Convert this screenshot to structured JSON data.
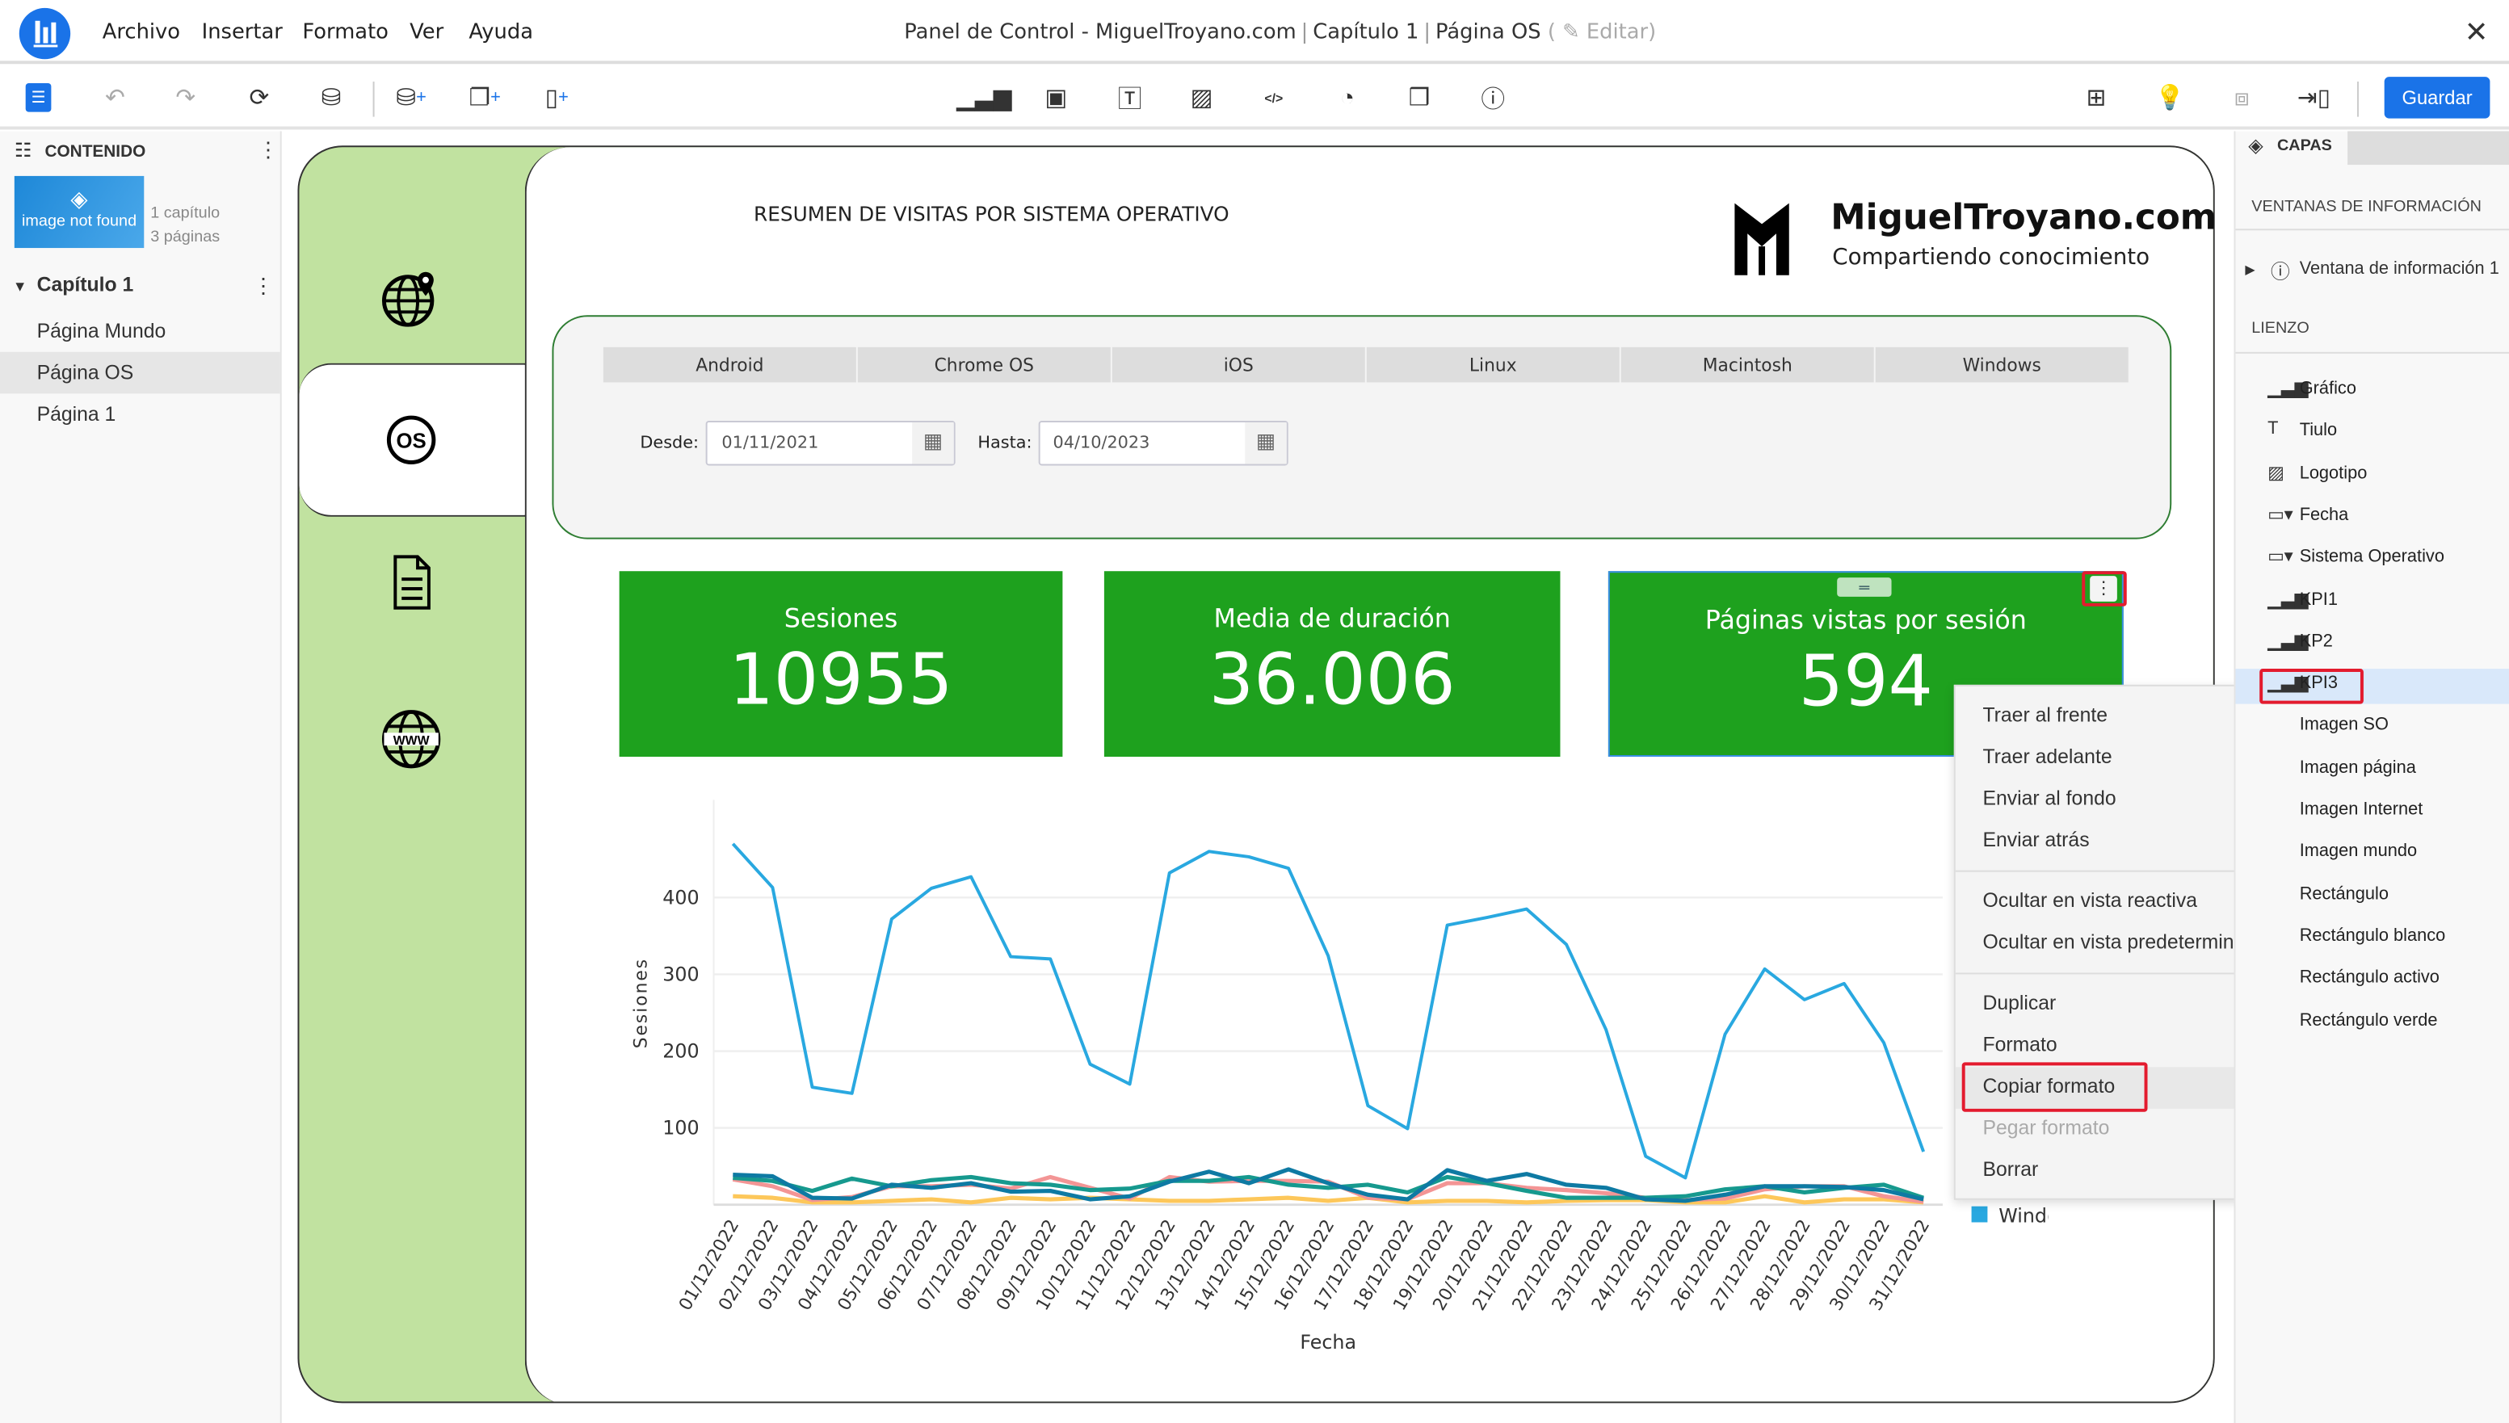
{
  "app": {
    "menu": [
      "Archivo",
      "Insertar",
      "Formato",
      "Ver",
      "Ayuda"
    ],
    "title": {
      "dashboard": "Panel de Control - MiguelTroyano.com",
      "chapter": "Capítulo 1",
      "page": "Página OS",
      "edit": "Editar"
    },
    "save_label": "Guardar"
  },
  "toolbar": {
    "icons": [
      "list-icon",
      "undo-icon",
      "redo-icon",
      "refresh-icon",
      "database-info-icon",
      "add-database-icon",
      "add-copy-page-icon",
      "add-page-icon",
      "chart-icon",
      "dropdown-icon",
      "text-icon",
      "image-icon",
      "html-icon",
      "shape-icon",
      "container-icon",
      "info-window-icon",
      "layout-icon",
      "bulb-chart-icon",
      "fit-icon",
      "resize-icon"
    ]
  },
  "content": {
    "header": "CONTENIDO",
    "thumb_text": "image not found",
    "chapters_count": "1 capítulo",
    "pages_count": "3 páginas",
    "chapter": "Capítulo 1",
    "pages": [
      "Página Mundo",
      "Página OS",
      "Página 1"
    ],
    "selected_page": "Página OS"
  },
  "layers": {
    "tab": "CAPAS",
    "section_info": "VENTANAS DE INFORMACIÓN",
    "info_window": "Ventana de información 1",
    "section_canvas": "LIENZO",
    "items": [
      {
        "label": "Gráfico",
        "icon": "chart-icon"
      },
      {
        "label": "Tiulo",
        "icon": "text-icon"
      },
      {
        "label": "Logotipo",
        "icon": "image-icon"
      },
      {
        "label": "Fecha",
        "icon": "dropdown-icon"
      },
      {
        "label": "Sistema Operativo",
        "icon": "dropdown-icon"
      },
      {
        "label": "KPI1",
        "icon": "chart-icon"
      },
      {
        "label": "KP2",
        "icon": "chart-icon"
      },
      {
        "label": "KPI3",
        "icon": "chart-icon"
      },
      {
        "label": "Imagen SO",
        "icon": "image-icon"
      },
      {
        "label": "Imagen página",
        "icon": "image-icon"
      },
      {
        "label": "Imagen Internet",
        "icon": "image-icon"
      },
      {
        "label": "Imagen mundo",
        "icon": "image-icon"
      },
      {
        "label": "Rectángulo",
        "icon": "shape-icon"
      },
      {
        "label": "Rectángulo blanco",
        "icon": "shape-icon"
      },
      {
        "label": "Rectángulo activo",
        "icon": "shape-icon"
      },
      {
        "label": "Rectángulo verde",
        "icon": "shape-icon"
      }
    ],
    "selected": "KPI3"
  },
  "page": {
    "title": "RESUMEN DE VISITAS POR SISTEMA OPERATIVO",
    "brand": "MiguelTroyano.com",
    "tagline": "Compartiendo conocimiento",
    "os_tabs": [
      "Android",
      "Chrome OS",
      "iOS",
      "Linux",
      "Macintosh",
      "Windows"
    ],
    "from_label": "Desde:",
    "from_value": "01/11/2021",
    "to_label": "Hasta:",
    "to_value": "04/10/2023",
    "kpis": [
      {
        "title": "Sesiones",
        "value": "10955"
      },
      {
        "title": "Media de duración",
        "value": "36.006"
      },
      {
        "title": "Páginas vistas por sesión",
        "value": "594"
      }
    ]
  },
  "context_menu": {
    "items": [
      "Traer al frente",
      "Traer adelante",
      "Enviar al fondo",
      "Enviar atrás",
      "Ocultar en vista reactiva",
      "Ocultar en vista predeterminada",
      "Duplicar",
      "Formato",
      "Copiar formato",
      "Pegar formato",
      "Borrar"
    ],
    "highlighted": "Copiar formato",
    "disabled": [
      "Pegar formato"
    ]
  },
  "colors": {
    "accent": "#1a73e8",
    "kpi_green": "#1ea11e",
    "sidebar_green": "#c1e2a0",
    "highlight_red": "#e31b2e"
  },
  "chart_data": {
    "type": "line",
    "xlabel": "Fecha",
    "ylabel": "Sesiones",
    "ylim": [
      0,
      520
    ],
    "yticks": [
      100,
      200,
      300,
      400
    ],
    "grid": true,
    "legend": "right",
    "categories": [
      "01/12/2022",
      "02/12/2022",
      "03/12/2022",
      "04/12/2022",
      "05/12/2022",
      "06/12/2022",
      "07/12/2022",
      "08/12/2022",
      "09/12/2022",
      "10/12/2022",
      "11/12/2022",
      "12/12/2022",
      "13/12/2022",
      "14/12/2022",
      "15/12/2022",
      "16/12/2022",
      "17/12/2022",
      "18/12/2022",
      "19/12/2022",
      "20/12/2022",
      "21/12/2022",
      "22/12/2022",
      "23/12/2022",
      "24/12/2022",
      "25/12/2022",
      "26/12/2022",
      "27/12/2022",
      "28/12/2022",
      "29/12/2022",
      "30/12/2022",
      "31/12/2022"
    ],
    "series": [
      {
        "name": "Windows",
        "color": "#29a8e0",
        "values": [
          470,
          413,
          153,
          145,
          372,
          412,
          427,
          323,
          320,
          183,
          157,
          432,
          460,
          453,
          438,
          324,
          129,
          99,
          364,
          374,
          385,
          339,
          228,
          63,
          35,
          222,
          307,
          267,
          288,
          211,
          69
        ]
      },
      {
        "color": "#0e7aa3",
        "values": [
          39,
          37,
          9,
          8,
          26,
          22,
          28,
          17,
          18,
          7,
          11,
          30,
          43,
          28,
          46,
          28,
          13,
          7,
          45,
          31,
          40,
          26,
          22,
          7,
          5,
          13,
          24,
          24,
          23,
          19,
          7
        ]
      },
      {
        "color": "#16998e",
        "values": [
          35,
          31,
          18,
          34,
          24,
          32,
          36,
          28,
          26,
          19,
          21,
          31,
          31,
          36,
          26,
          22,
          26,
          16,
          36,
          28,
          18,
          9,
          9,
          9,
          11,
          20,
          24,
          16,
          22,
          26,
          9
        ]
      },
      {
        "color": "#f39595",
        "values": [
          33,
          24,
          6,
          10,
          24,
          24,
          26,
          21,
          36,
          22,
          8,
          36,
          30,
          31,
          31,
          30,
          9,
          7,
          28,
          28,
          22,
          19,
          15,
          9,
          6,
          8,
          20,
          24,
          24,
          11,
          4
        ]
      },
      {
        "color": "#fdc75a",
        "values": [
          11,
          9,
          3,
          3,
          5,
          7,
          3,
          9,
          7,
          9,
          7,
          5,
          5,
          7,
          9,
          5,
          9,
          3,
          5,
          5,
          3,
          5,
          6,
          6,
          3,
          3,
          11,
          3,
          7,
          7,
          3
        ]
      }
    ]
  }
}
